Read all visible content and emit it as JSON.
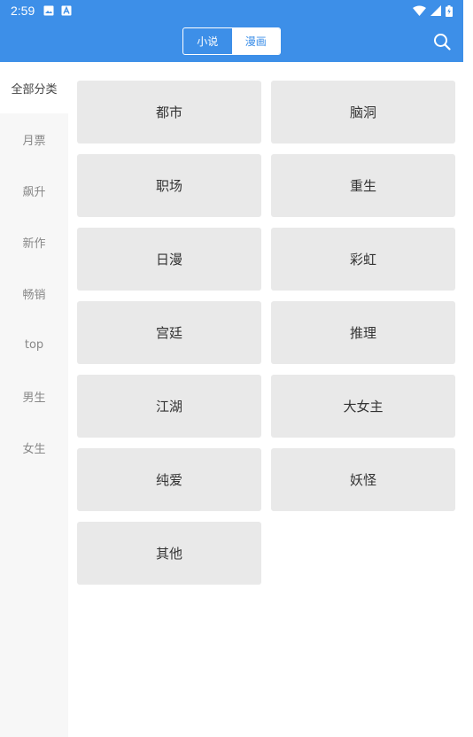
{
  "status_bar": {
    "time": "2:59",
    "icons": [
      "image-icon",
      "a-icon",
      "wifi-icon",
      "signal-icon",
      "battery-icon"
    ]
  },
  "header": {
    "tabs": [
      {
        "label": "小说",
        "active": false
      },
      {
        "label": "漫画",
        "active": true
      }
    ],
    "search_icon": "search-icon"
  },
  "sidebar": {
    "items": [
      {
        "label": "全部分类",
        "active": true
      },
      {
        "label": "月票",
        "active": false
      },
      {
        "label": "飙升",
        "active": false
      },
      {
        "label": "新作",
        "active": false
      },
      {
        "label": "畅销",
        "active": false
      },
      {
        "label": "top",
        "active": false
      },
      {
        "label": "男生",
        "active": false
      },
      {
        "label": "女生",
        "active": false
      }
    ]
  },
  "categories": [
    "都市",
    "脑洞",
    "职场",
    "重生",
    "日漫",
    "彩虹",
    "宫廷",
    "推理",
    "江湖",
    "大女主",
    "纯爱",
    "妖怪",
    "其他"
  ],
  "colors": {
    "primary": "#3d8fe8",
    "sidebar_bg": "#f7f7f7",
    "cell_bg": "#e9e9e9",
    "text": "#333333",
    "muted_text": "#888888"
  }
}
